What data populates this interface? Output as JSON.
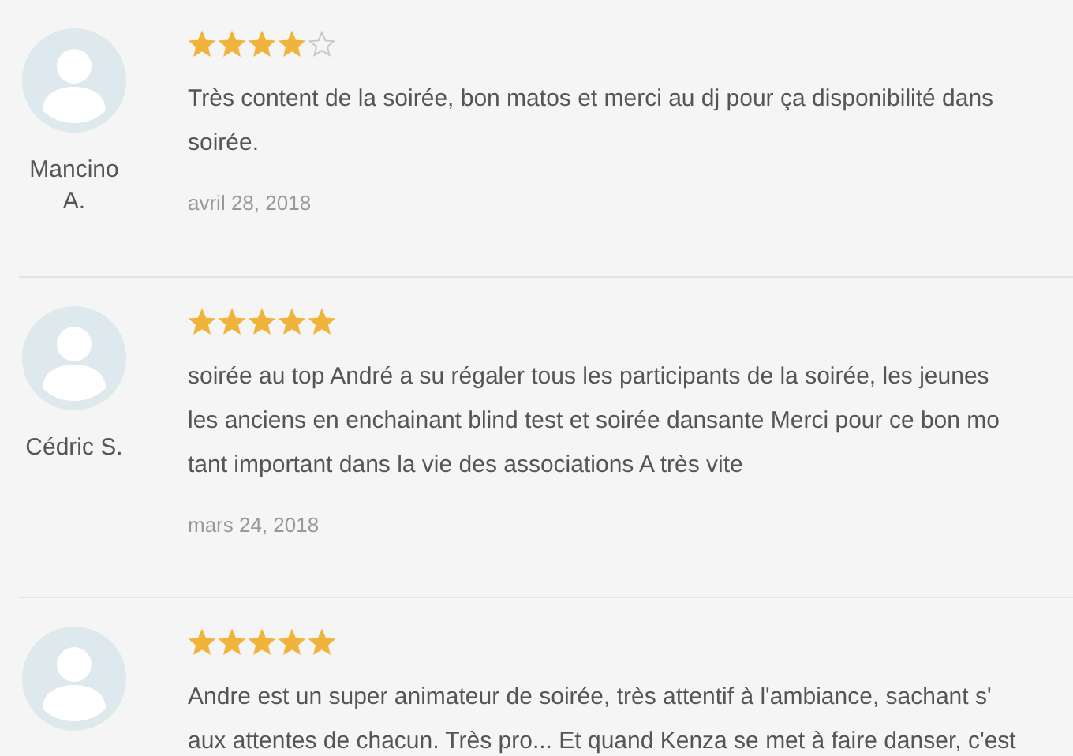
{
  "reviews": [
    {
      "author": "Mancino A.",
      "stars": 4,
      "lines": [
        "Très content de la soirée, bon matos et merci au dj pour ça disponibilité dans",
        "soirée."
      ],
      "date": "avril 28, 2018"
    },
    {
      "author": "Cédric S.",
      "stars": 5,
      "lines": [
        "soirée au top André a su régaler tous les participants de la soirée, les jeunes",
        "les anciens en enchainant blind test et soirée dansante Merci pour ce bon mo",
        "tant important dans la vie des associations A très vite"
      ],
      "date": "mars 24, 2018"
    },
    {
      "stars": 5,
      "lines": [
        "Andre est un super animateur de soirée, très attentif à l'ambiance, sachant s'",
        "aux attentes de chacun. Très pro... Et quand Kenza se met à faire danser, c'est"
      ]
    }
  ]
}
